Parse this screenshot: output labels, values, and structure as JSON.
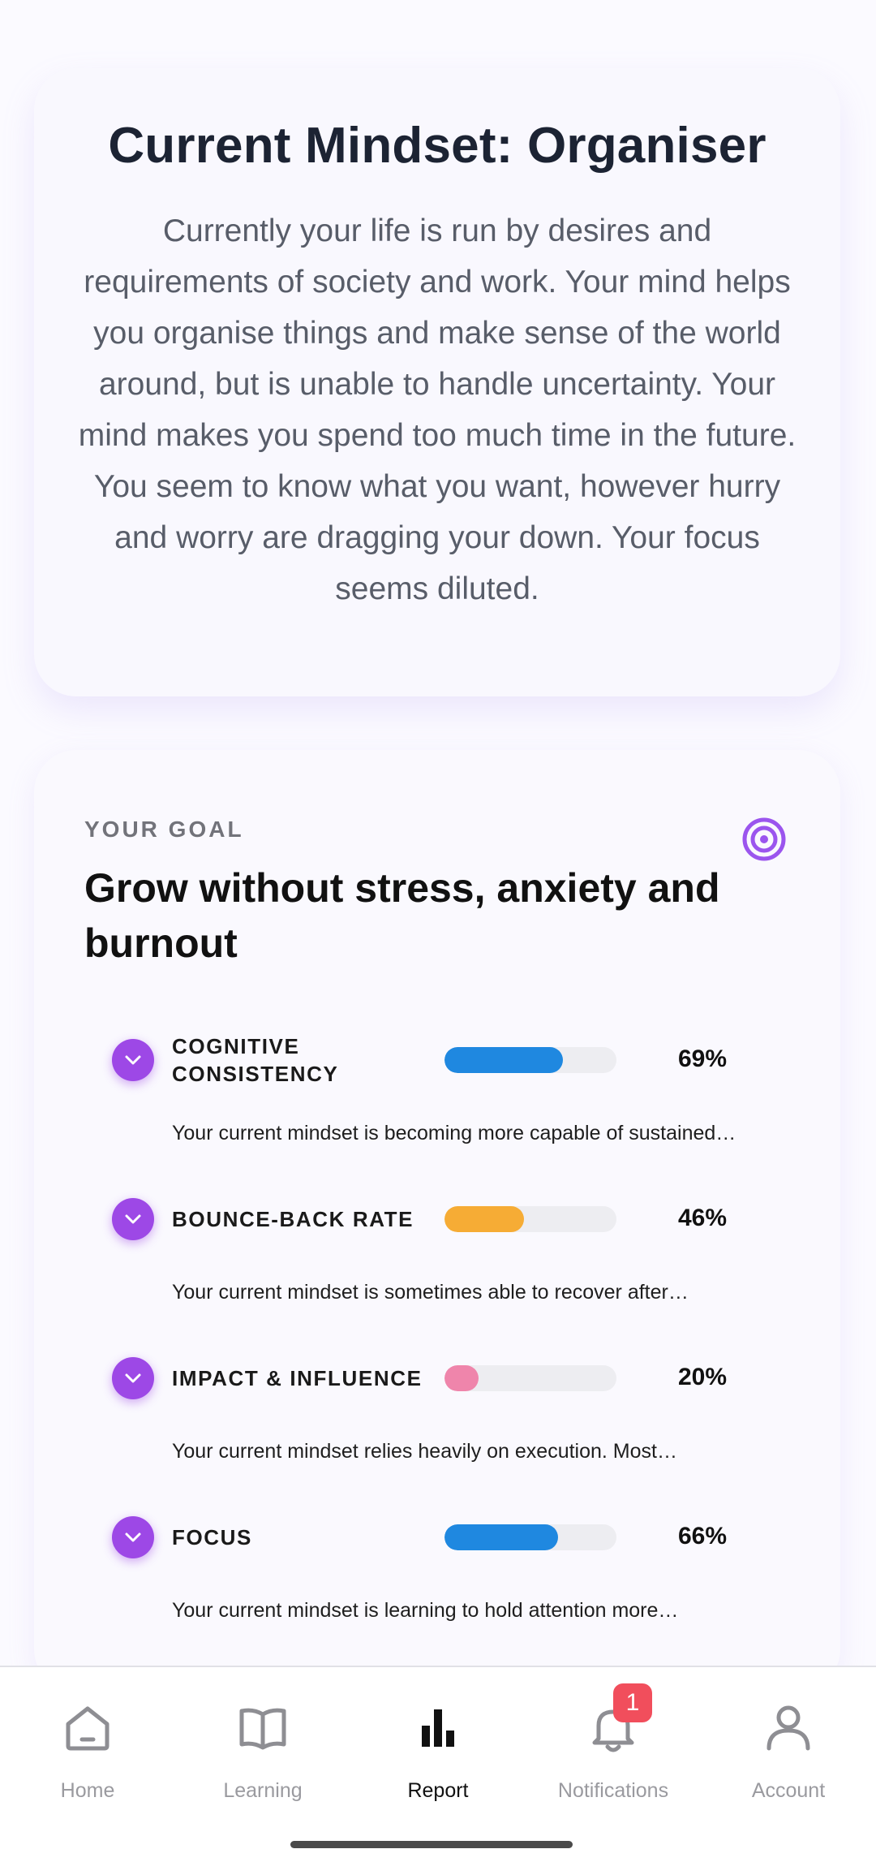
{
  "mindset": {
    "title": "Current Mindset: Organiser",
    "description": "Currently your life is run by desires and requirements of society and work. Your mind helps you organise things and make sense of the world around, but is unable to handle uncertainty. Your mind makes you spend too much time in the future. You seem to know what you want, however hurry and worry are dragging your down. Your focus seems diluted."
  },
  "goal": {
    "label": "YOUR GOAL",
    "title": "Grow without stress, anxiety and burnout",
    "icon": "target-icon",
    "metrics": [
      {
        "name": "COGNITIVE CONSISTENCY",
        "percent_label": "69%",
        "value": 69,
        "color": "#1f88e0",
        "description": "Your current mindset is becoming more capable of sustained…"
      },
      {
        "name": "BOUNCE-BACK RATE",
        "percent_label": "46%",
        "value": 46,
        "color": "#f6ac35",
        "description": "Your current mindset is sometimes able to recover after…"
      },
      {
        "name": "IMPACT & INFLUENCE",
        "percent_label": "20%",
        "value": 20,
        "color": "#ef85ab",
        "description": "Your current mindset relies heavily on execution. Most…"
      },
      {
        "name": "FOCUS",
        "percent_label": "66%",
        "value": 66,
        "color": "#1f88e0",
        "description": "Your current mindset is learning to hold attention more…"
      }
    ]
  },
  "nav": {
    "items": [
      {
        "label": "Home",
        "icon": "home-icon"
      },
      {
        "label": "Learning",
        "icon": "book-icon"
      },
      {
        "label": "Report",
        "icon": "bar-chart-icon",
        "active": true
      },
      {
        "label": "Notifications",
        "icon": "bell-icon"
      },
      {
        "label": "Account",
        "icon": "user-icon"
      }
    ],
    "notification_badge": "1"
  },
  "colors": {
    "accent_purple": "#9d48e6",
    "badge_red": "#f14e5c"
  }
}
